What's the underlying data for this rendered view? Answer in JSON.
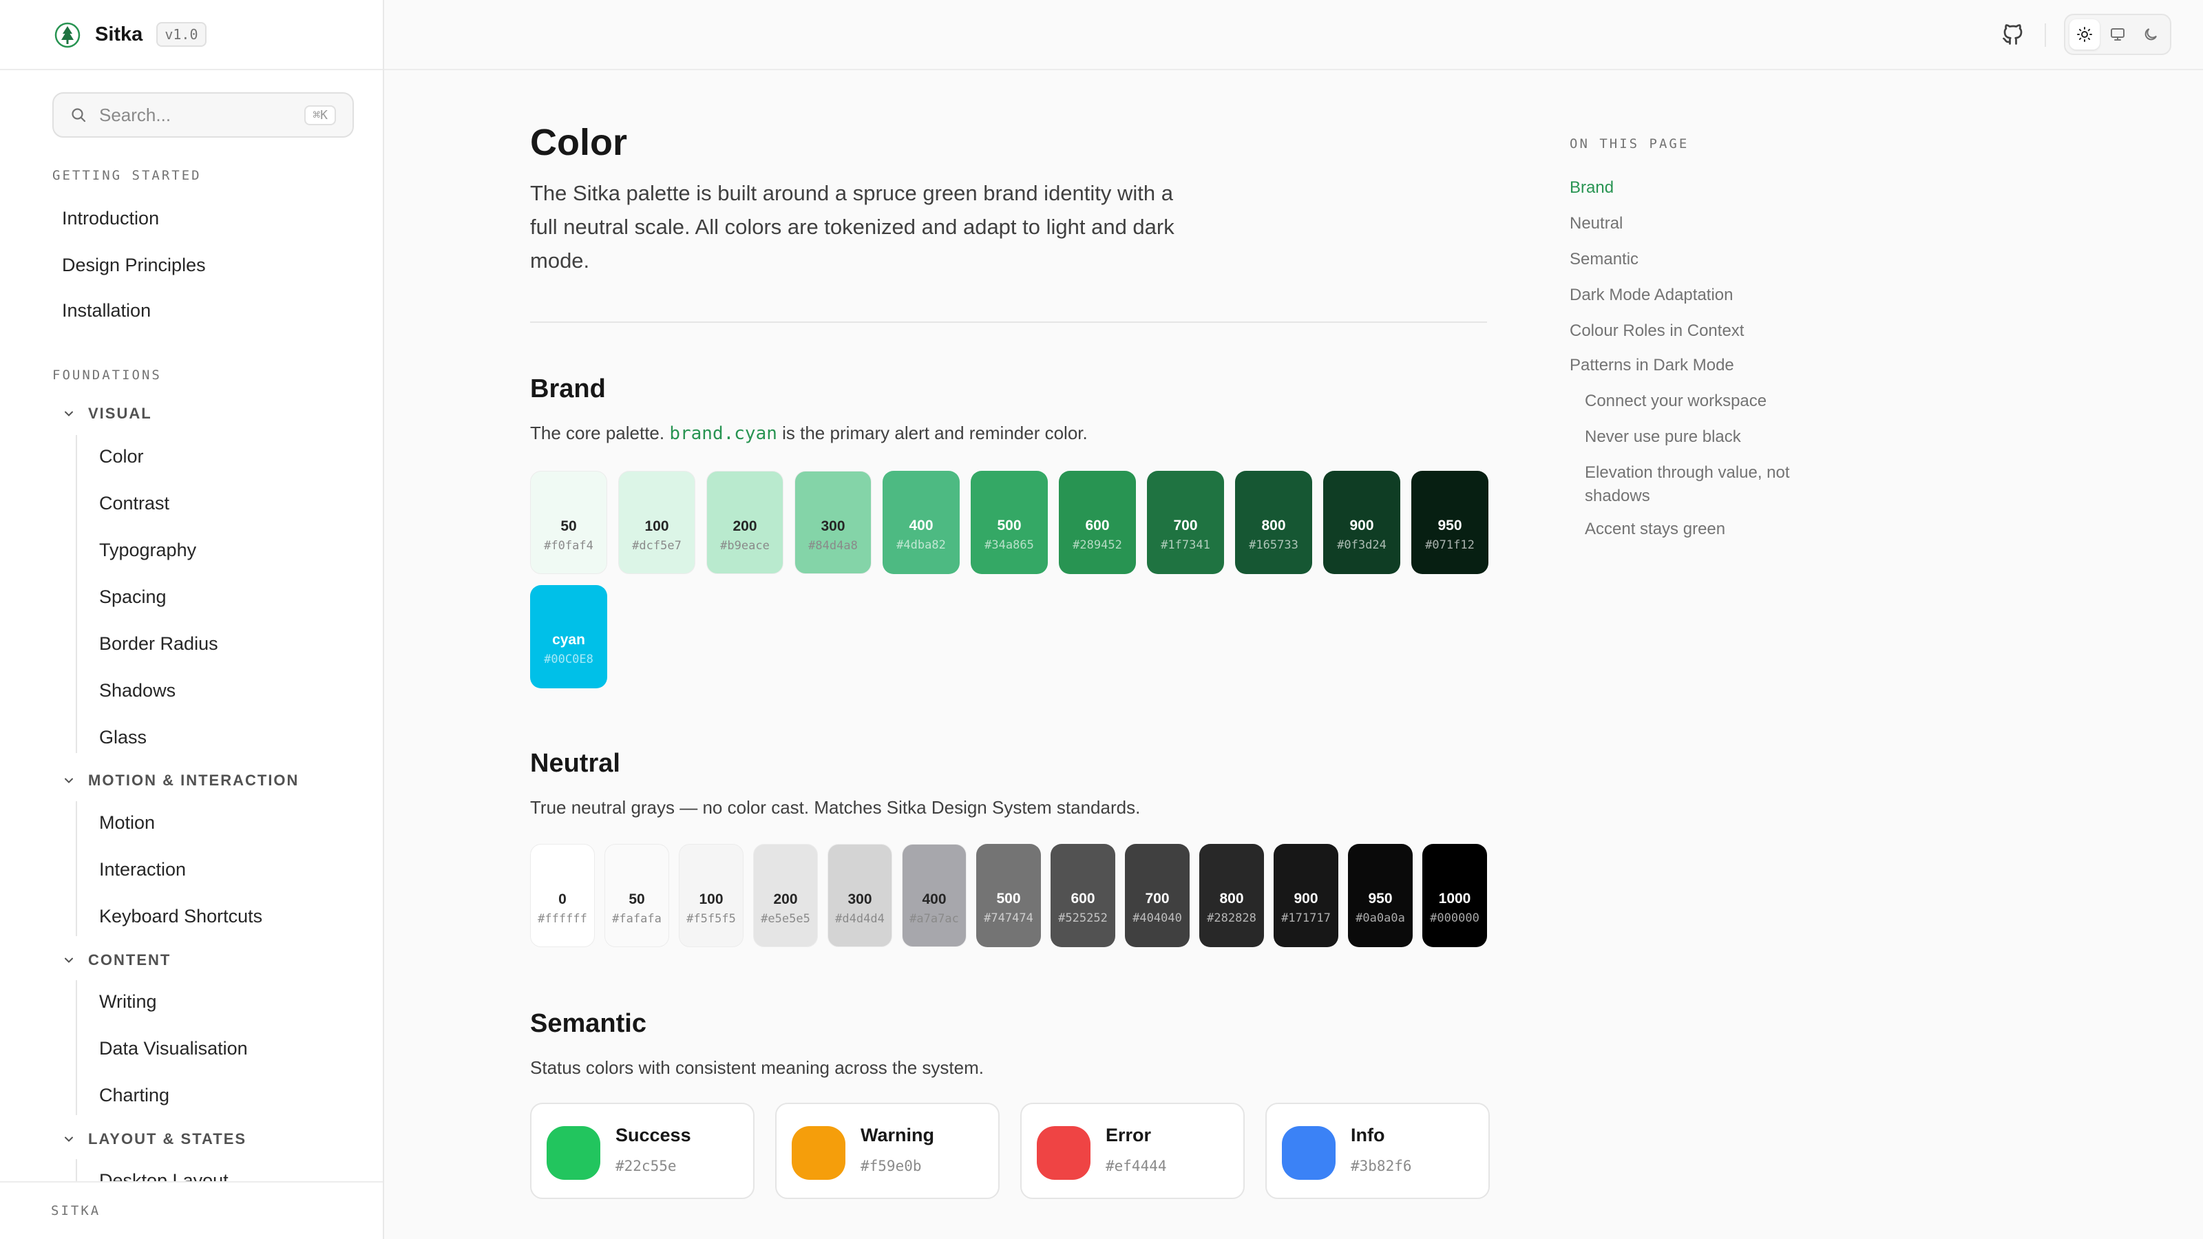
{
  "app": {
    "name": "Sitka",
    "version": "v1.0"
  },
  "search": {
    "placeholder": "Search...",
    "shortcut": "⌘K"
  },
  "sidebar": {
    "getting_started": {
      "title": "GETTING STARTED",
      "items": [
        "Introduction",
        "Design Principles",
        "Installation"
      ]
    },
    "foundations": {
      "title": "FOUNDATIONS",
      "groups": [
        {
          "label": "VISUAL",
          "items": [
            "Color",
            "Contrast",
            "Typography",
            "Spacing",
            "Border Radius",
            "Shadows",
            "Glass"
          ]
        },
        {
          "label": "MOTION & INTERACTION",
          "items": [
            "Motion",
            "Interaction",
            "Keyboard Shortcuts"
          ]
        },
        {
          "label": "CONTENT",
          "items": [
            "Writing",
            "Data Visualisation",
            "Charting"
          ]
        },
        {
          "label": "LAYOUT & STATES",
          "items": [
            "Desktop Layout"
          ]
        }
      ]
    },
    "footer": "SITKA"
  },
  "topbar": {
    "icons": [
      "github-icon",
      "sun-icon",
      "monitor-icon",
      "moon-icon"
    ],
    "active_theme": "light"
  },
  "page": {
    "title": "Color",
    "intro": "The Sitka palette is built around a spruce green brand identity with a full neutral scale. All colors are tokenized and adapt to light and dark mode."
  },
  "brand": {
    "title": "Brand",
    "desc_before": "The core palette. ",
    "desc_code": "brand.cyan",
    "desc_after": " is the primary alert and reminder color.",
    "swatches": [
      {
        "name": "50",
        "hex": "#f0faf4"
      },
      {
        "name": "100",
        "hex": "#dcf5e7"
      },
      {
        "name": "200",
        "hex": "#b9eace"
      },
      {
        "name": "300",
        "hex": "#84d4a8"
      },
      {
        "name": "400",
        "hex": "#4dba82"
      },
      {
        "name": "500",
        "hex": "#34a865"
      },
      {
        "name": "600",
        "hex": "#289452"
      },
      {
        "name": "700",
        "hex": "#1f7341"
      },
      {
        "name": "800",
        "hex": "#165733"
      },
      {
        "name": "900",
        "hex": "#0f3d24"
      },
      {
        "name": "950",
        "hex": "#071f12"
      },
      {
        "name": "cyan",
        "hex": "#00C0E8"
      }
    ]
  },
  "neutral": {
    "title": "Neutral",
    "desc": "True neutral grays — no color cast. Matches Sitka Design System standards.",
    "swatches": [
      {
        "name": "0",
        "hex": "#ffffff"
      },
      {
        "name": "50",
        "hex": "#fafafa"
      },
      {
        "name": "100",
        "hex": "#f5f5f5"
      },
      {
        "name": "200",
        "hex": "#e5e5e5"
      },
      {
        "name": "300",
        "hex": "#d4d4d4"
      },
      {
        "name": "400",
        "hex": "#a7a7ac"
      },
      {
        "name": "500",
        "hex": "#747474"
      },
      {
        "name": "600",
        "hex": "#525252"
      },
      {
        "name": "700",
        "hex": "#404040"
      },
      {
        "name": "800",
        "hex": "#282828"
      },
      {
        "name": "900",
        "hex": "#171717"
      },
      {
        "name": "950",
        "hex": "#0a0a0a"
      },
      {
        "name": "1000",
        "hex": "#000000"
      }
    ]
  },
  "semantic": {
    "title": "Semantic",
    "desc": "Status colors with consistent meaning across the system.",
    "items": [
      {
        "name": "Success",
        "hex": "#22c55e"
      },
      {
        "name": "Warning",
        "hex": "#f59e0b"
      },
      {
        "name": "Error",
        "hex": "#ef4444"
      },
      {
        "name": "Info",
        "hex": "#3b82f6"
      }
    ]
  },
  "toc": {
    "title": "ON THIS PAGE",
    "items": [
      {
        "label": "Brand",
        "active": true
      },
      {
        "label": "Neutral"
      },
      {
        "label": "Semantic"
      },
      {
        "label": "Dark Mode Adaptation"
      },
      {
        "label": "Colour Roles in Context"
      },
      {
        "label": "Patterns in Dark Mode"
      },
      {
        "label": "Connect your workspace",
        "sub": true
      },
      {
        "label": "Never use pure black",
        "sub": true
      },
      {
        "label": "Elevation through value, not shadows",
        "sub": true
      },
      {
        "label": "Accent stays green",
        "sub": true
      }
    ]
  },
  "colors": {
    "accent": "#289452",
    "border": "#e5e5e5",
    "background": "#fafafa"
  }
}
